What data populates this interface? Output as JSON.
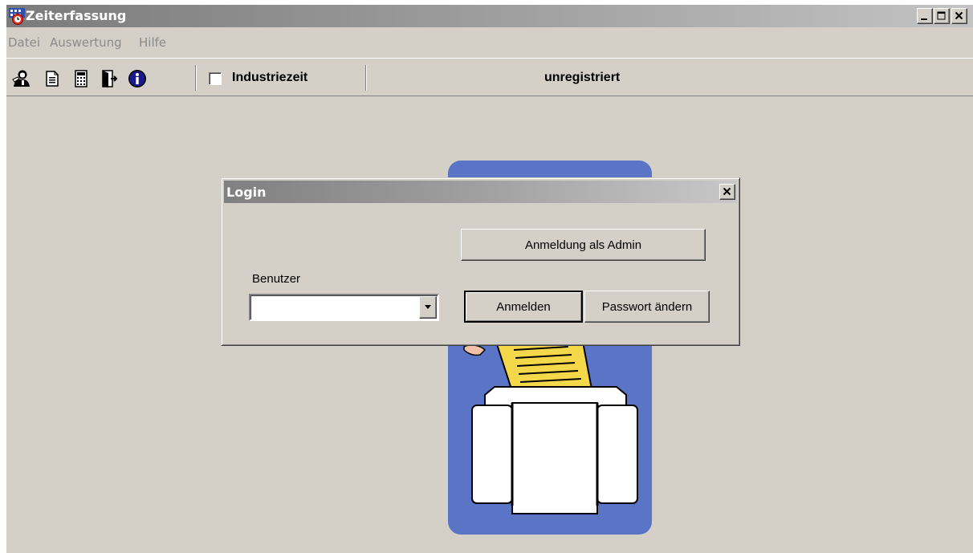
{
  "window": {
    "title": "Zeiterfassung"
  },
  "menu": {
    "items": [
      "Datei",
      "Auswertung",
      "Hilfe"
    ]
  },
  "toolbar": {
    "icons": [
      "user-icon",
      "document-icon",
      "calculator-icon",
      "exit-door-icon",
      "info-icon"
    ],
    "industriezeit_label": "Industriezeit",
    "industriezeit_checked": false,
    "status_text": "unregistriert"
  },
  "login_dialog": {
    "title": "Login",
    "admin_button": "Anmeldung als Admin",
    "user_label": "Benutzer",
    "user_value": "",
    "login_button": "Anmelden",
    "change_password_button": "Passwort ändern"
  },
  "colors": {
    "window_bg": "#d4d0c8",
    "illustration_blue": "#5a74c6",
    "illustration_yellow": "#f5d84a"
  }
}
